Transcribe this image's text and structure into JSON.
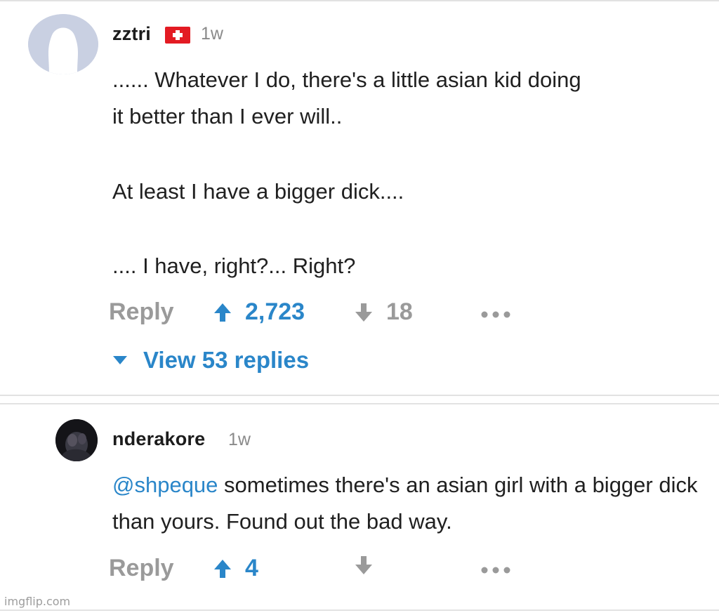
{
  "comments": [
    {
      "username": "zztri",
      "timestamp": "1w",
      "lines": [
        "...... Whatever I do, there's a little asian kid doing",
        "it better than I ever will..",
        "At least I have a bigger dick....",
        ".... I have, right?... Right?"
      ],
      "reply_label": "Reply",
      "upvotes": "2,723",
      "downvotes": "18",
      "view_replies": "View 53 replies"
    },
    {
      "username": "nderakore",
      "timestamp": "1w",
      "mention": "@shpeque",
      "text": " sometimes there's an asian girl with a bigger dick than yours. Found out the bad way.",
      "reply_label": "Reply",
      "upvotes": "4",
      "downvotes": ""
    }
  ],
  "watermark": "imgflip.com",
  "colors": {
    "accent": "#2a86c9",
    "muted": "#9a9a9a",
    "flag_red": "#e31b23"
  },
  "icons": {
    "flag": "swiss-flag-icon",
    "upvote": "arrow-up-icon",
    "downvote": "arrow-down-icon",
    "more": "more-dots-icon",
    "expand": "caret-down-icon",
    "avatar_default": "default-avatar-icon"
  }
}
